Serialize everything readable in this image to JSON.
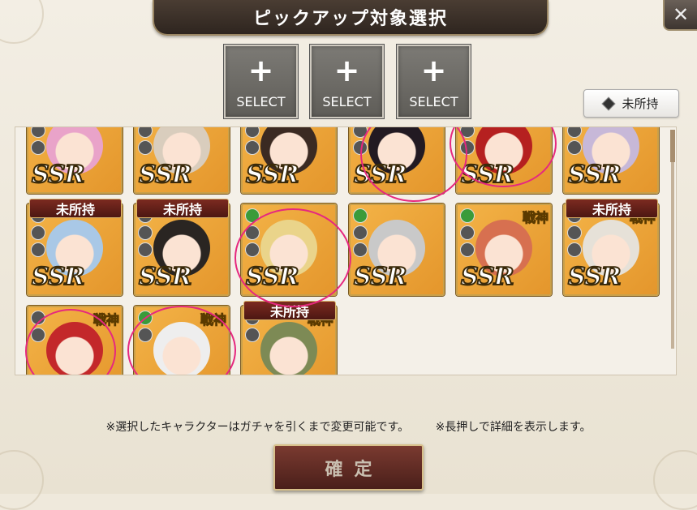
{
  "title": "ピックアップ対象選択",
  "close_label": "✕",
  "select_slots": [
    {
      "plus": "+",
      "label": "SELECT"
    },
    {
      "plus": "+",
      "label": "SELECT"
    },
    {
      "plus": "+",
      "label": "SELECT"
    }
  ],
  "filter_button": {
    "label": "未所持",
    "icon": "diamond-icon"
  },
  "rarity_label": "SSR",
  "unowned_label": "未所持",
  "god_label": "戦神",
  "cards": [
    {
      "rarity": "SSR",
      "unowned": false,
      "god": false,
      "bg": "#f3b347",
      "hair": "#e9a3c9",
      "icons": [
        "gray",
        "gray",
        "gray"
      ]
    },
    {
      "rarity": "SSR",
      "unowned": false,
      "god": false,
      "bg": "#f3b347",
      "hair": "#d9cdbd",
      "icons": [
        "gray",
        "gray",
        "gray"
      ]
    },
    {
      "rarity": "SSR",
      "unowned": false,
      "god": false,
      "bg": "#f3b347",
      "hair": "#3b2a22",
      "icons": [
        "gray",
        "gray",
        "gray"
      ]
    },
    {
      "rarity": "SSR",
      "unowned": false,
      "god": false,
      "bg": "#f3b347",
      "hair": "#221a22",
      "icons": [
        "gray",
        "gray",
        "gray"
      ]
    },
    {
      "rarity": "SSR",
      "unowned": false,
      "god": false,
      "bg": "#f3b347",
      "hair": "#b52020",
      "icons": [
        "gray",
        "gray",
        "gray"
      ]
    },
    {
      "rarity": "SSR",
      "unowned": false,
      "god": false,
      "bg": "#f3b347",
      "hair": "#c7b8d8",
      "icons": [
        "gray",
        "gray",
        "gray"
      ]
    },
    {
      "rarity": "SSR",
      "unowned": true,
      "god": false,
      "bg": "#f3b347",
      "hair": "#a9c8e6",
      "icons": [
        "gray",
        "gray",
        "gray"
      ]
    },
    {
      "rarity": "SSR",
      "unowned": true,
      "god": false,
      "bg": "#f3b347",
      "hair": "#2a2522",
      "icons": [
        "gray",
        "gray",
        "gray"
      ]
    },
    {
      "rarity": "SSR",
      "unowned": false,
      "god": false,
      "bg": "#f3b347",
      "hair": "#ead48a",
      "icons": [
        "green",
        "gray",
        "gray"
      ]
    },
    {
      "rarity": "SSR",
      "unowned": false,
      "god": false,
      "bg": "#f3b347",
      "hair": "#c9c9c9",
      "icons": [
        "green",
        "gray",
        "gray"
      ]
    },
    {
      "rarity": "SSR",
      "unowned": false,
      "god": true,
      "bg": "#f3b347",
      "hair": "#d77050",
      "icons": [
        "green",
        "gray",
        "gray"
      ]
    },
    {
      "rarity": "SSR",
      "unowned": true,
      "god": true,
      "bg": "#f3b347",
      "hair": "#e6e1d8",
      "icons": [
        "gray",
        "gray",
        "gray"
      ]
    },
    {
      "rarity": "",
      "unowned": false,
      "god": true,
      "bg": "#f3b347",
      "hair": "#c3282a",
      "icons": [
        "gray",
        "gray"
      ]
    },
    {
      "rarity": "",
      "unowned": false,
      "god": true,
      "bg": "#f3b347",
      "hair": "#eeeeee",
      "icons": [
        "green",
        "gray"
      ]
    },
    {
      "rarity": "",
      "unowned": true,
      "god": true,
      "bg": "#f3b347",
      "hair": "#7d8a55",
      "icons": [
        "gray",
        "gray"
      ]
    }
  ],
  "notes": [
    "※選択したキャラクターはガチャを引くまで変更可能です。",
    "※長押しで詳細を表示します。"
  ],
  "confirm_label": "確定",
  "colors": {
    "accent_circle": "#e6287f",
    "card_border": "#c9a04a",
    "unowned_tag": "#6b241c"
  }
}
